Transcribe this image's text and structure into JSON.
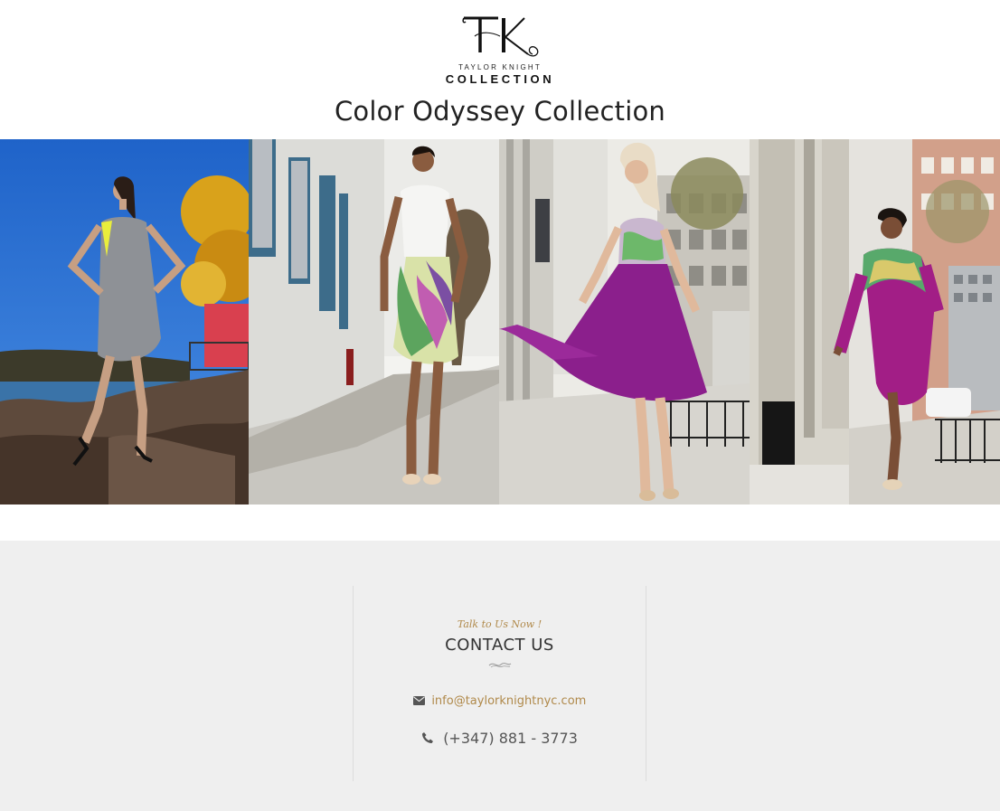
{
  "logo": {
    "monogram": "TK",
    "line1": "TAYLOR KNIGHT",
    "line2": "COLLECTION"
  },
  "page_title": "Color Odyssey Collection",
  "gallery": {
    "photos": [
      {
        "name": "grey-dress-riverside"
      },
      {
        "name": "white-printed-dress-street"
      },
      {
        "name": "purple-skirt-street"
      },
      {
        "name": "purple-printed-tunic-street"
      }
    ]
  },
  "contact": {
    "tagline": "Talk to Us Now !",
    "title": "CONTACT US",
    "email": "info@taylorknightnyc.com",
    "phone": "(+347) 881 - 3773",
    "icons": {
      "email": "envelope-icon",
      "phone": "phone-icon",
      "divider": "swash-divider-icon"
    }
  },
  "colors": {
    "accent": "#b0894a",
    "footer_bg": "#efefef",
    "title": "#222222"
  }
}
